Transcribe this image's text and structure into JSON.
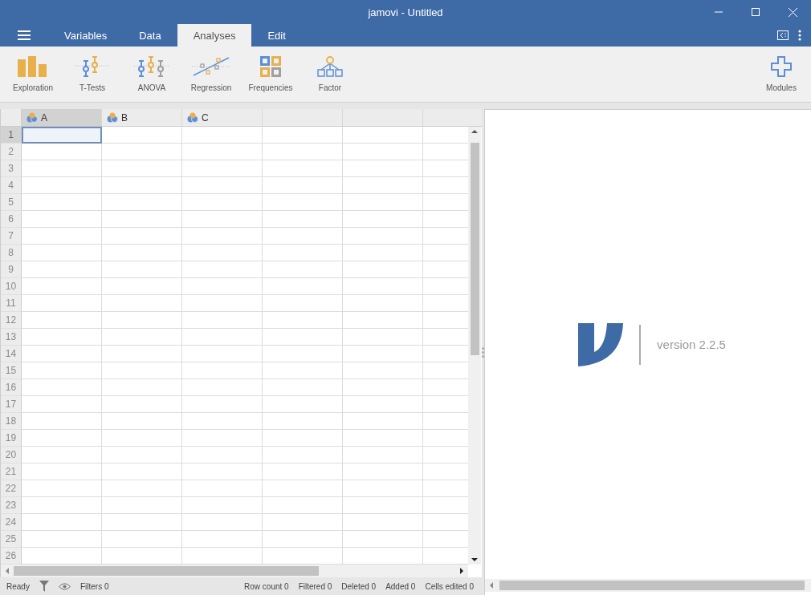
{
  "window": {
    "title": "jamovi - Untitled"
  },
  "tabs": [
    {
      "label": "Variables",
      "selected": false
    },
    {
      "label": "Data",
      "selected": false
    },
    {
      "label": "Analyses",
      "selected": true
    },
    {
      "label": "Edit",
      "selected": false
    }
  ],
  "ribbon": [
    {
      "kind": "exploration",
      "label": "Exploration"
    },
    {
      "kind": "ttests",
      "label": "T-Tests"
    },
    {
      "kind": "anova",
      "label": "ANOVA"
    },
    {
      "kind": "regression",
      "label": "Regression"
    },
    {
      "kind": "frequencies",
      "label": "Frequencies"
    },
    {
      "kind": "factor",
      "label": "Factor"
    }
  ],
  "modules": {
    "label": "Modules"
  },
  "columns": [
    {
      "name": "A",
      "selected": true
    },
    {
      "name": "B",
      "selected": false
    },
    {
      "name": "C",
      "selected": false
    }
  ],
  "rows": [
    {
      "number": "1",
      "selected": true
    },
    {
      "number": "2",
      "selected": false
    },
    {
      "number": "3",
      "selected": false
    },
    {
      "number": "4",
      "selected": false
    },
    {
      "number": "5",
      "selected": false
    },
    {
      "number": "6",
      "selected": false
    },
    {
      "number": "7",
      "selected": false
    },
    {
      "number": "8",
      "selected": false
    },
    {
      "number": "9",
      "selected": false
    },
    {
      "number": "10",
      "selected": false
    },
    {
      "number": "11",
      "selected": false
    },
    {
      "number": "12",
      "selected": false
    },
    {
      "number": "13",
      "selected": false
    },
    {
      "number": "14",
      "selected": false
    },
    {
      "number": "15",
      "selected": false
    },
    {
      "number": "16",
      "selected": false
    },
    {
      "number": "17",
      "selected": false
    },
    {
      "number": "18",
      "selected": false
    },
    {
      "number": "19",
      "selected": false
    },
    {
      "number": "20",
      "selected": false
    },
    {
      "number": "21",
      "selected": false
    },
    {
      "number": "22",
      "selected": false
    },
    {
      "number": "23",
      "selected": false
    },
    {
      "number": "24",
      "selected": false
    },
    {
      "number": "25",
      "selected": false
    },
    {
      "number": "26",
      "selected": false
    }
  ],
  "results": {
    "version": "version 2.2.5"
  },
  "status_bar": {
    "ready": "Ready",
    "filters": "Filters 0",
    "counts": [
      "Row count 0",
      "Filtered 0",
      "Deleted 0",
      "Added 0",
      "Cells edited 0"
    ]
  }
}
